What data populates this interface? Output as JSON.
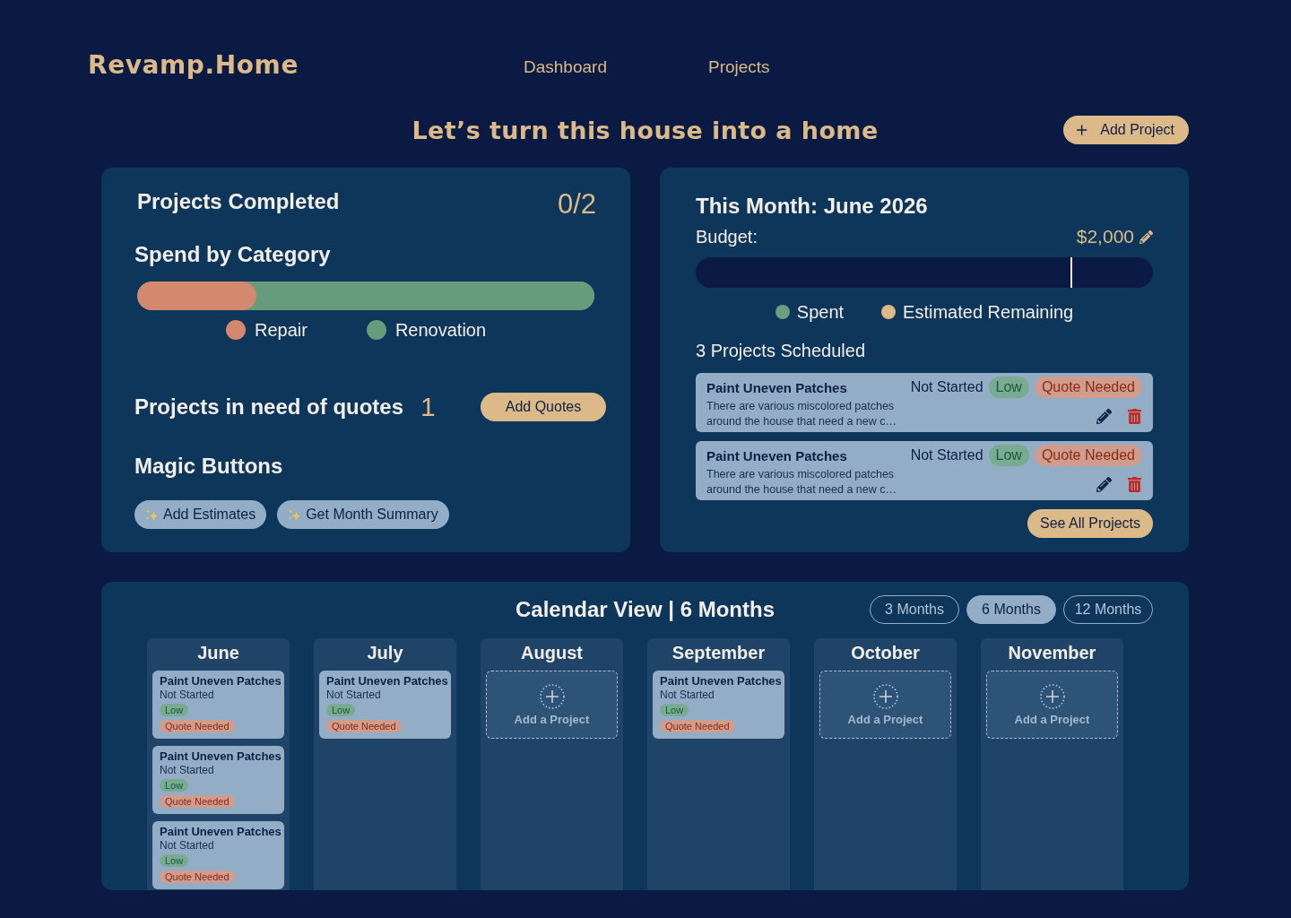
{
  "header": {
    "logo": "Revamp.Home",
    "nav": [
      "Dashboard",
      "Projects"
    ]
  },
  "hero": {
    "title": "Let’s turn this house into a home",
    "button": "Add Project"
  },
  "completed": {
    "title": "Projects Completed",
    "count": "0/2"
  },
  "spend": {
    "title": "Spend by Category",
    "categories": [
      {
        "name": "Repair",
        "color": "#d4896f",
        "level": 0.26
      },
      {
        "name": "Renovation",
        "color": "#669b7c",
        "level": 0.74
      }
    ]
  },
  "quotes": {
    "title": "Projects in need of quotes",
    "count": "1",
    "button": "Add Quotes"
  },
  "magic": {
    "title": "Magic Buttons",
    "buttons": [
      "Add Estimates",
      "Get Month Summary"
    ]
  },
  "month": {
    "title": "This Month: June 2026",
    "budget_label": "Budget:",
    "budget_amount": "$2,000",
    "marker": {
      "level": 0.82
    },
    "legend": [
      {
        "label": "Spent",
        "color": "#6a9e7f"
      },
      {
        "label": "Estimated Remaining",
        "color": "#dcb987"
      }
    ],
    "scheduled_title": "3 Projects Scheduled",
    "projects": [
      {
        "title": "Paint Uneven Patches",
        "description": "There are various miscolored patches around the house that need a new c…",
        "status": "Not Started",
        "tags": [
          {
            "label": "Low",
            "kind": "priority"
          },
          {
            "label": "Quote Needed",
            "kind": "quote"
          }
        ]
      },
      {
        "title": "Paint Uneven Patches",
        "description": "There are various miscolored patches around the house that need a new c…",
        "status": "Not Started",
        "tags": [
          {
            "label": "Low",
            "kind": "priority"
          },
          {
            "label": "Quote Needed",
            "kind": "quote"
          }
        ]
      }
    ],
    "button": "See All Projects"
  },
  "calendar": {
    "title": "Calendar View | 6 Months",
    "ranges": [
      {
        "label": "3 Months",
        "selected": false
      },
      {
        "label": "6 Months",
        "selected": true
      },
      {
        "label": "12 Months",
        "selected": false
      }
    ],
    "months": [
      {
        "name": "June",
        "projects": [
          {
            "title": "Paint Uneven Patches",
            "status": "Not Started",
            "tags": [
              {
                "label": "Low",
                "kind": "priority"
              },
              {
                "label": "Quote Needed",
                "kind": "quote"
              }
            ]
          },
          {
            "title": "Paint Uneven Patches",
            "status": "Not Started",
            "tags": [
              {
                "label": "Low",
                "kind": "priority"
              },
              {
                "label": "Quote Needed",
                "kind": "quote"
              }
            ]
          },
          {
            "title": "Paint Uneven Patches",
            "status": "Not Started",
            "tags": [
              {
                "label": "Low",
                "kind": "priority"
              },
              {
                "label": "Quote Needed",
                "kind": "quote"
              }
            ]
          }
        ]
      },
      {
        "name": "July",
        "projects": [
          {
            "title": "Paint Uneven Patches",
            "status": "Not Started",
            "tags": [
              {
                "label": "Low",
                "kind": "priority"
              },
              {
                "label": "Quote Needed",
                "kind": "quote"
              }
            ]
          }
        ]
      },
      {
        "name": "August",
        "add_label": "Add a Project"
      },
      {
        "name": "September",
        "projects": [
          {
            "title": "Paint Uneven Patches",
            "status": "Not Started",
            "tags": [
              {
                "label": "Low",
                "kind": "priority"
              },
              {
                "label": "Quote Needed",
                "kind": "quote"
              }
            ]
          }
        ]
      },
      {
        "name": "October",
        "add_label": "Add a Project"
      },
      {
        "name": "November",
        "add_label": "Add a Project"
      }
    ]
  }
}
